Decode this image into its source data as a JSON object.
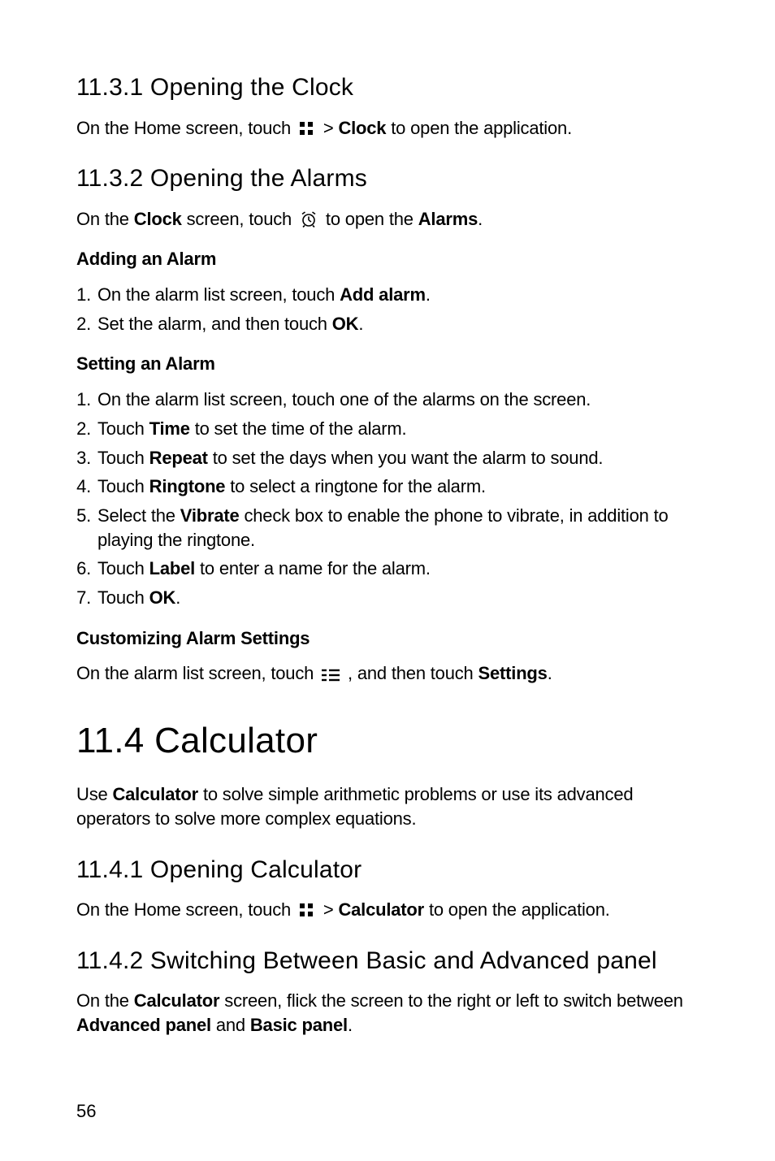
{
  "s_11_3_1": {
    "heading": "11.3.1  Opening the Clock",
    "p1_pre": "On the Home screen, touch ",
    "p1_mid": "  > ",
    "p1_bold": "Clock",
    "p1_post": " to open the application."
  },
  "s_11_3_2": {
    "heading": "11.3.2  Opening the Alarms",
    "p1_pre": "On the ",
    "p1_bold1": "Clock",
    "p1_mid": " screen, touch ",
    "p1_post_pre": "  to open the ",
    "p1_bold2": "Alarms",
    "p1_post": "."
  },
  "add_alarm": {
    "heading": "Adding an Alarm",
    "li1_pre": "On the alarm list screen, touch ",
    "li1_bold": "Add alarm",
    "li1_post": ".",
    "li2_pre": "Set the alarm, and then touch ",
    "li2_bold": "OK",
    "li2_post": "."
  },
  "set_alarm": {
    "heading": "Setting an Alarm",
    "li1": "On the alarm list screen, touch one of the alarms on the screen.",
    "li2_pre": "Touch ",
    "li2_bold": "Time",
    "li2_post": " to set the time of the alarm.",
    "li3_pre": "Touch ",
    "li3_bold": "Repeat",
    "li3_post": " to set the days when you want the alarm to sound.",
    "li4_pre": "Touch ",
    "li4_bold": "Ringtone",
    "li4_post": " to select a ringtone for the alarm.",
    "li5_pre": "Select the ",
    "li5_bold": "Vibrate",
    "li5_post": " check box to enable the phone to vibrate, in addition to playing the ringtone.",
    "li6_pre": "Touch ",
    "li6_bold": "Label",
    "li6_post": " to enter a name for the alarm.",
    "li7_pre": "Touch ",
    "li7_bold": "OK",
    "li7_post": "."
  },
  "custom_alarm": {
    "heading": "Customizing Alarm Settings",
    "p_pre": "On the alarm list screen, touch ",
    "p_mid": " , and then touch ",
    "p_bold": "Settings",
    "p_post": "."
  },
  "s_11_4": {
    "heading": "11.4  Calculator",
    "p_pre": "Use ",
    "p_bold": "Calculator",
    "p_post": " to solve simple arithmetic problems or use its advanced operators to solve more complex equations."
  },
  "s_11_4_1": {
    "heading": "11.4.1  Opening Calculator",
    "p_pre": "On the Home screen, touch ",
    "p_mid": "  > ",
    "p_bold": "Calculator",
    "p_post": " to open the application."
  },
  "s_11_4_2": {
    "heading": "11.4.2  Switching Between Basic and Advanced panel",
    "p_pre": "On the ",
    "p_bold1": "Calculator",
    "p_mid": " screen, flick the screen to the right or left to switch between ",
    "p_bold2": "Advanced panel",
    "p_and": " and ",
    "p_bold3": "Basic panel",
    "p_post": "."
  },
  "page_number": "56"
}
